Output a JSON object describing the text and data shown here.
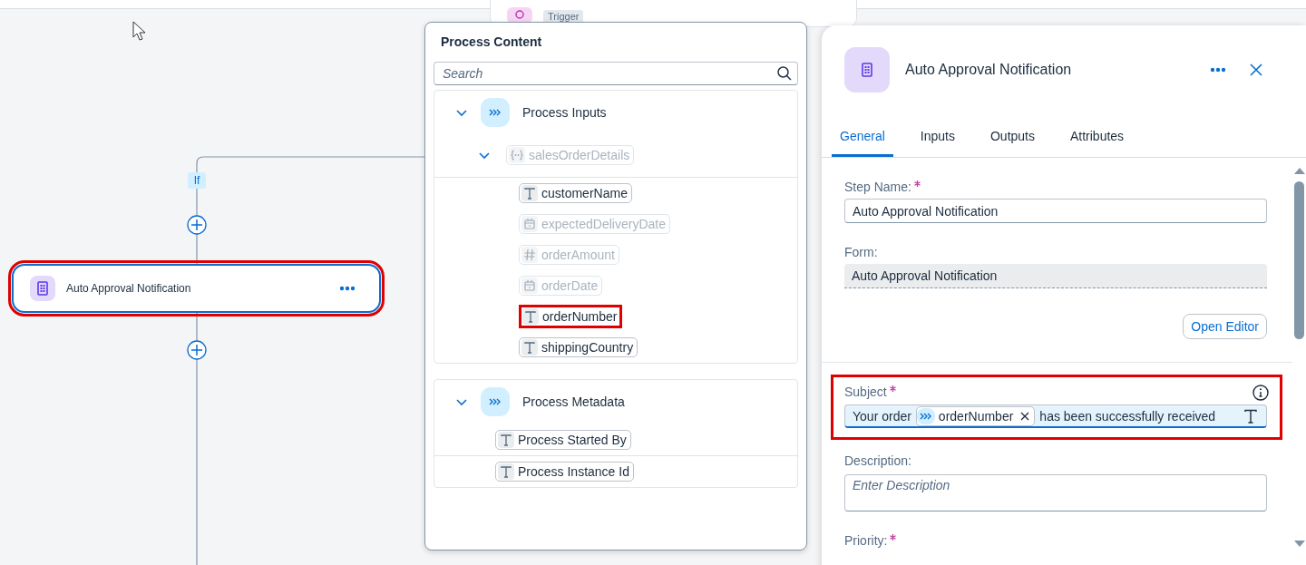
{
  "canvas": {
    "trigger": {
      "tag": "Trigger"
    },
    "branch_label": "If",
    "node": {
      "title": "Auto Approval Notification",
      "highlighted": true
    }
  },
  "process_content": {
    "title": "Process Content",
    "search": {
      "placeholder": "Search"
    },
    "groups": [
      {
        "label": "Process Inputs",
        "expanded": true,
        "children": [
          {
            "label": "salesOrderDetails",
            "kind": "structure",
            "disabled": true,
            "expanded": true,
            "children": [
              {
                "label": "customerName",
                "kind": "text",
                "disabled": false,
                "highlighted": false
              },
              {
                "label": "expectedDeliveryDate",
                "kind": "date",
                "disabled": true,
                "highlighted": false
              },
              {
                "label": "orderAmount",
                "kind": "number",
                "disabled": true,
                "highlighted": false
              },
              {
                "label": "orderDate",
                "kind": "date",
                "disabled": true,
                "highlighted": false
              },
              {
                "label": "orderNumber",
                "kind": "text",
                "disabled": false,
                "highlighted": true
              },
              {
                "label": "shippingCountry",
                "kind": "text",
                "disabled": false,
                "highlighted": false
              }
            ]
          }
        ]
      },
      {
        "label": "Process Metadata",
        "expanded": true,
        "children": [
          {
            "label": "Process Started By",
            "kind": "text",
            "disabled": false,
            "highlighted": false
          },
          {
            "label": "Process Instance Id",
            "kind": "text",
            "disabled": false,
            "highlighted": false
          }
        ]
      }
    ]
  },
  "details": {
    "title": "Auto Approval Notification",
    "tabs": [
      {
        "label": "General",
        "selected": true
      },
      {
        "label": "Inputs",
        "selected": false
      },
      {
        "label": "Outputs",
        "selected": false
      },
      {
        "label": "Attributes",
        "selected": false
      }
    ],
    "fields": [
      {
        "kind": "input",
        "label": "Step Name:",
        "required": true,
        "value": "Auto Approval Notification"
      },
      {
        "kind": "readonly",
        "label": "Form:",
        "required": false,
        "value": "Auto Approval Notification",
        "button": "Open Editor"
      },
      {
        "kind": "tokens",
        "label": "Subject",
        "required": true,
        "highlighted": true,
        "segments": [
          {
            "kind": "text",
            "text": "Your order"
          },
          {
            "kind": "token",
            "text": "orderNumber"
          },
          {
            "kind": "text",
            "text": "has been successfully received"
          }
        ]
      },
      {
        "kind": "textarea",
        "label": "Description:",
        "required": false,
        "placeholder": "Enter Description"
      },
      {
        "kind": "label",
        "label": "Priority:",
        "required": true
      }
    ]
  }
}
